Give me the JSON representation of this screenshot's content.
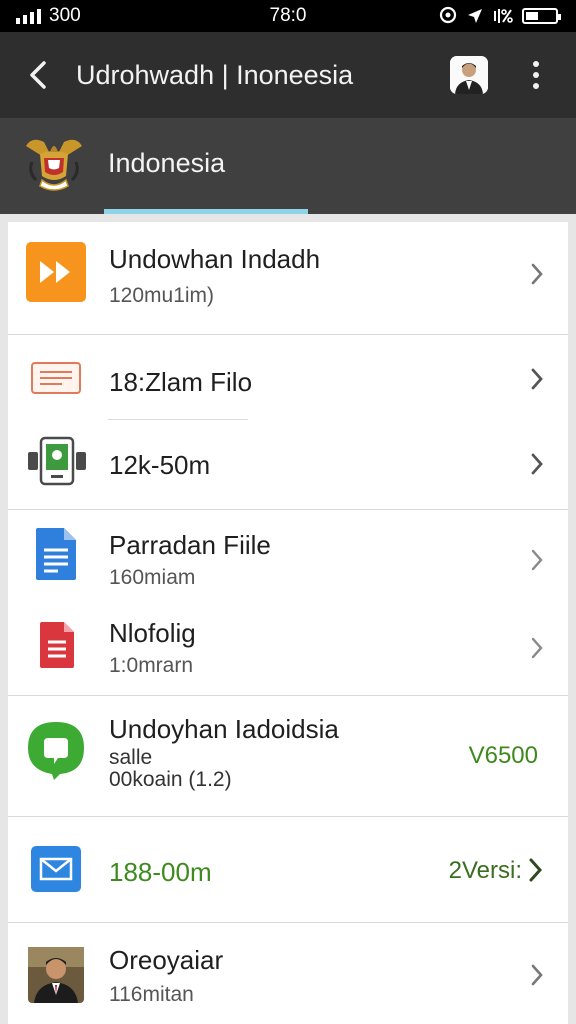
{
  "status_bar": {
    "carrier": "300",
    "time": "78:0"
  },
  "app_bar": {
    "title": "Udrohwadh | Inoneesia"
  },
  "tab": {
    "label": "Indonesia"
  },
  "list": {
    "items": [
      {
        "title": "Undowhan Indadh",
        "subtitle": "120mu1im)"
      },
      {
        "title": "18:Zlam Filo"
      },
      {
        "title": "12k-50m"
      },
      {
        "title": "Parradan Fiile",
        "subtitle": "160miam"
      },
      {
        "title": "Nlofolig",
        "subtitle": "1:0mrarn"
      },
      {
        "title": "Undoyhan Iadoidsia",
        "subtitle": "salle",
        "subtitle2": "00koain (1.2)",
        "trailing": "V6500"
      },
      {
        "title": "188-00m",
        "trailing": "2Versi:"
      },
      {
        "title": "Oreoyaiar",
        "subtitle": "116mitan"
      }
    ]
  },
  "colors": {
    "appbar": "#2e2e2e",
    "tabrow": "#404040",
    "tab_indicator": "#8fd3e6",
    "green_text": "#3f8a1f",
    "orange_icon": "#f7941d"
  }
}
